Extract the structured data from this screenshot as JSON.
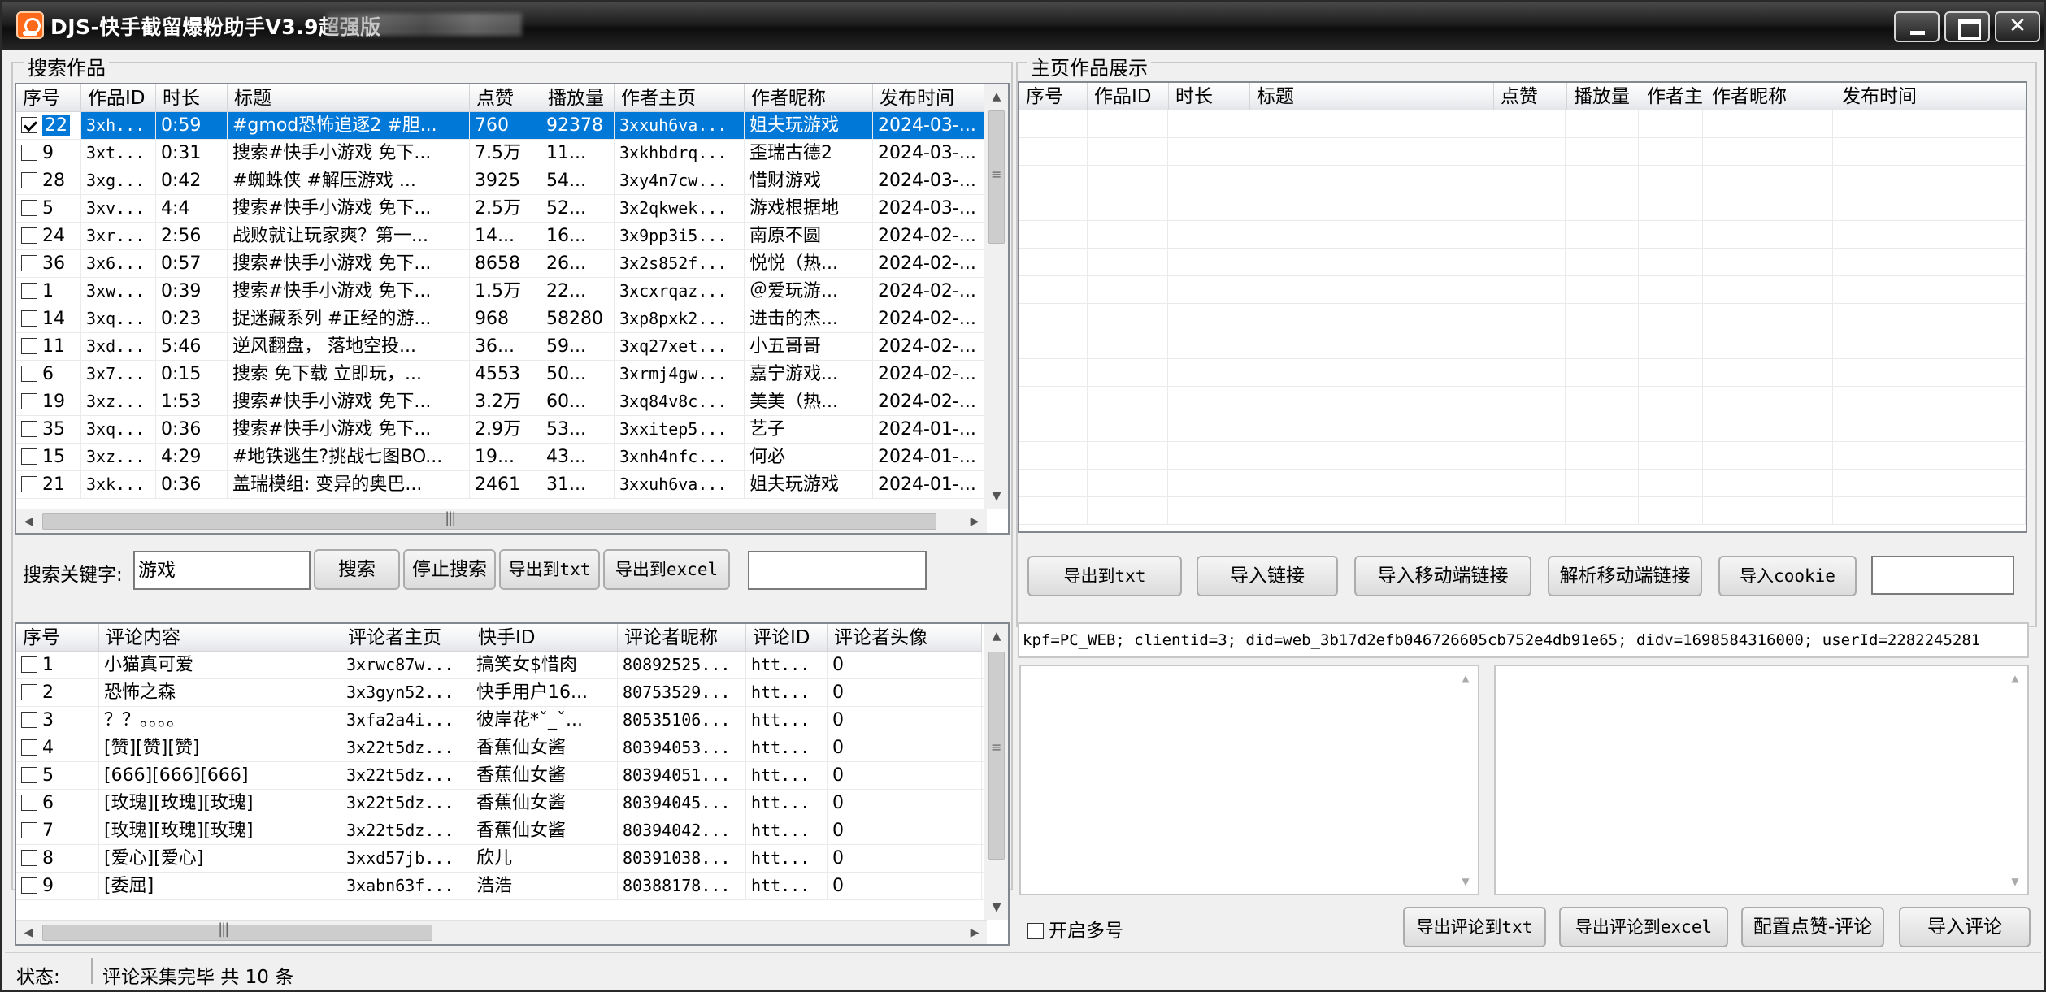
{
  "window": {
    "title": "DJS-快手截留爆粉助手V3.9超强版"
  },
  "search_panel": {
    "label": "搜索作品",
    "columns": [
      "序号",
      "作品ID",
      "时长",
      "标题",
      "点赞",
      "播放量",
      "作者主页",
      "作者昵称",
      "发布时间"
    ],
    "rows": [
      {
        "checked": true,
        "cells": [
          "22",
          "3xh...",
          "0:59",
          "#gmod恐怖追逐2 #胆...",
          "760",
          "92378",
          "3xxuh6va...",
          "姐夫玩游戏",
          "2024-03-..."
        ]
      },
      {
        "checked": false,
        "cells": [
          "9",
          "3xt...",
          "0:31",
          "搜索#快手小游戏 免下...",
          "7.5万",
          "11...",
          "3xkhbdrq...",
          "歪瑞古德2",
          "2024-03-..."
        ]
      },
      {
        "checked": false,
        "cells": [
          "28",
          "3xg...",
          "0:42",
          "#蜘蛛侠 #解压游戏 ...",
          "3925",
          "54...",
          "3xy4n7cw...",
          "惜财游戏",
          "2024-03-..."
        ]
      },
      {
        "checked": false,
        "cells": [
          "5",
          "3xv...",
          "4:4",
          "搜索#快手小游戏 免下...",
          "2.5万",
          "52...",
          "3x2qkwek...",
          "游戏根据地",
          "2024-03-..."
        ]
      },
      {
        "checked": false,
        "cells": [
          "24",
          "3xr...",
          "2:56",
          "战败就让玩家爽？第一...",
          "14...",
          "16...",
          "3x9pp3i5...",
          "南原不圆",
          "2024-02-..."
        ]
      },
      {
        "checked": false,
        "cells": [
          "36",
          "3x6...",
          "0:57",
          "搜索#快手小游戏 免下...",
          "8658",
          "26...",
          "3x2s852f...",
          "悦悦（热...",
          "2024-02-..."
        ]
      },
      {
        "checked": false,
        "cells": [
          "1",
          "3xw...",
          "0:39",
          "搜索#快手小游戏 免下...",
          "1.5万",
          "22...",
          "3xcxrqaz...",
          "＠爱玩游...",
          "2024-02-..."
        ]
      },
      {
        "checked": false,
        "cells": [
          "14",
          "3xq...",
          "0:23",
          "捉迷藏系列 #正经的游...",
          "968",
          "58280",
          "3xp8pxk2...",
          "进击的杰...",
          "2024-02-..."
        ]
      },
      {
        "checked": false,
        "cells": [
          "11",
          "3xd...",
          "5:46",
          "逆风翻盘， 落地空投...",
          "36...",
          "59...",
          "3xq27xet...",
          "小五哥哥",
          "2024-02-..."
        ]
      },
      {
        "checked": false,
        "cells": [
          "6",
          "3x7...",
          "0:15",
          "搜索 免下载 立即玩，...",
          "4553",
          "50...",
          "3xrmj4gw...",
          "嘉宁游戏...",
          "2024-02-..."
        ]
      },
      {
        "checked": false,
        "cells": [
          "19",
          "3xz...",
          "1:53",
          "搜索#快手小游戏 免下...",
          "3.2万",
          "60...",
          "3xq84v8c...",
          "美美（热...",
          "2024-02-..."
        ]
      },
      {
        "checked": false,
        "cells": [
          "35",
          "3xq...",
          "0:36",
          "搜索#快手小游戏 免下...",
          "2.9万",
          "53...",
          "3xxitep5...",
          "艺子",
          "2024-01-..."
        ]
      },
      {
        "checked": false,
        "cells": [
          "15",
          "3xz...",
          "4:29",
          "#地铁逃生?挑战七图BO...",
          "19...",
          "43...",
          "3xnh4nfc...",
          "何必",
          "2024-01-..."
        ]
      },
      {
        "checked": false,
        "cells": [
          "21",
          "3xk...",
          "0:36",
          "盖瑞模组: 变异的奥巴...",
          "2461",
          "31...",
          "3xxuh6va...",
          "姐夫玩游戏",
          "2024-01-..."
        ]
      }
    ],
    "keyword_label": "搜索关键字:",
    "keyword_value": "游戏",
    "buttons": {
      "search": "搜索",
      "stop": "停止搜索",
      "export_txt": "导出到txt",
      "export_excel": "导出到excel"
    }
  },
  "home_panel": {
    "label": "主页作品展示",
    "columns": [
      "序号",
      "作品ID",
      "时长",
      "标题",
      "点赞",
      "播放量",
      "作者主",
      "作者昵称",
      "发布时间"
    ],
    "buttons": {
      "export_txt": "导出到txt",
      "import_link": "导入链接",
      "import_mobile": "导入移动端链接",
      "parse_mobile": "解析移动端链接",
      "import_cookie": "导入cookie"
    }
  },
  "comments_panel": {
    "columns": [
      "序号",
      "评论内容",
      "评论者主页",
      "快手ID",
      "评论者昵称",
      "评论ID",
      "评论者头像"
    ],
    "rows": [
      {
        "cells": [
          "1",
          "小猫真可爱",
          "3xrwc87w...",
          "搞笑女$惜肉",
          "80892525...",
          "htt...",
          "0"
        ]
      },
      {
        "cells": [
          "2",
          "恐怖之森",
          "3x3gyn52...",
          "快手用户16...",
          "80753529...",
          "htt...",
          "0"
        ]
      },
      {
        "cells": [
          "3",
          "？？。。。。",
          "3xfa2a4i...",
          "彼岸花*ˇ_ˇ...",
          "80535106...",
          "htt...",
          "0"
        ]
      },
      {
        "cells": [
          "4",
          "[赞][赞][赞]",
          "3x22t5dz...",
          "香蕉仙女酱",
          "80394053...",
          "htt...",
          "0"
        ]
      },
      {
        "cells": [
          "5",
          "[666][666][666]",
          "3x22t5dz...",
          "香蕉仙女酱",
          "80394051...",
          "htt...",
          "0"
        ]
      },
      {
        "cells": [
          "6",
          "[玫瑰][玫瑰][玫瑰]",
          "3x22t5dz...",
          "香蕉仙女酱",
          "80394045...",
          "htt...",
          "0"
        ]
      },
      {
        "cells": [
          "7",
          "[玫瑰][玫瑰][玫瑰]",
          "3x22t5dz...",
          "香蕉仙女酱",
          "80394042...",
          "htt...",
          "0"
        ]
      },
      {
        "cells": [
          "8",
          "[爱心][爱心]",
          "3xxd57jb...",
          "欣儿",
          "80391038...",
          "htt...",
          "0"
        ]
      },
      {
        "cells": [
          "9",
          "[委屈]",
          "3xabn63f...",
          "浩浩",
          "80388178...",
          "htt...",
          "0"
        ]
      }
    ]
  },
  "cookie_text": "kpf=PC_WEB; clientid=3; did=web_3b17d2efb046726605cb752e4db91e65; didv=1698584316000; userId=2282245281",
  "comment_tools": {
    "multi_account_label": "开启多号",
    "buttons": {
      "export_txt": "导出评论到txt",
      "export_excel": "导出评论到excel",
      "config_like": "配置点赞-评论",
      "import_comments": "导入评论"
    }
  },
  "status": {
    "label": "状态:",
    "text": "评论采集完毕 共 10 条"
  },
  "colors": {
    "selection": "#0078d7",
    "titlebar": "#1e1e1e"
  }
}
